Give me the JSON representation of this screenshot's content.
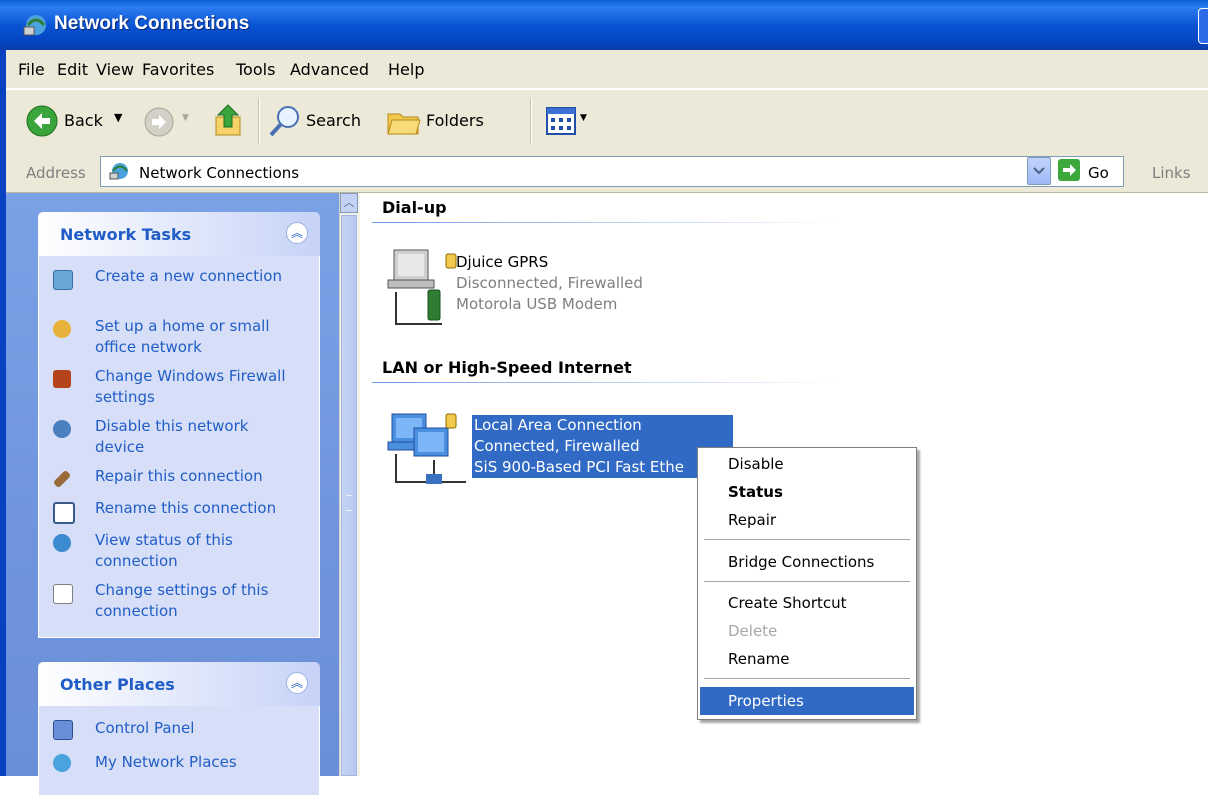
{
  "window": {
    "title": "Network Connections"
  },
  "menubar": {
    "items": [
      "File",
      "Edit",
      "View",
      "Favorites",
      "Tools",
      "Advanced",
      "Help"
    ]
  },
  "toolbar": {
    "back_label": "Back",
    "search_label": "Search",
    "folders_label": "Folders"
  },
  "address_bar": {
    "label": "Address",
    "value": "Network Connections",
    "go_label": "Go",
    "links_label": "Links"
  },
  "task_pane": {
    "network_tasks": {
      "title": "Network Tasks",
      "items": [
        {
          "label": "Create a new connection",
          "icon": "new-connection-icon"
        },
        {
          "label": "Set up a home or small office network",
          "icon": "home-network-icon"
        },
        {
          "label": "Change Windows Firewall settings",
          "icon": "firewall-icon"
        },
        {
          "label": "Disable this network device",
          "icon": "disable-device-icon"
        },
        {
          "label": "Repair this connection",
          "icon": "repair-icon"
        },
        {
          "label": "Rename this connection",
          "icon": "rename-icon"
        },
        {
          "label": "View status of this connection",
          "icon": "status-icon"
        },
        {
          "label": "Change settings of this connection",
          "icon": "settings-icon"
        }
      ]
    },
    "other_places": {
      "title": "Other Places",
      "items": [
        {
          "label": "Control Panel",
          "icon": "control-panel-icon"
        },
        {
          "label": "My Network Places",
          "icon": "network-places-icon"
        }
      ]
    }
  },
  "content": {
    "groups": [
      {
        "title": "Dial-up",
        "connections": [
          {
            "name": "Djuice GPRS",
            "status": "Disconnected, Firewalled",
            "device": "Motorola USB Modem"
          }
        ]
      },
      {
        "title": "LAN or High-Speed Internet",
        "connections": [
          {
            "name": "Local Area Connection",
            "status": "Connected, Firewalled",
            "device": "SiS 900-Based PCI Fast Ethe"
          }
        ]
      }
    ]
  },
  "context_menu": {
    "items": [
      {
        "label": "Disable"
      },
      {
        "label": "Status",
        "bold": true
      },
      {
        "label": "Repair"
      },
      {
        "label": "Bridge Connections"
      },
      {
        "label": "Create Shortcut"
      },
      {
        "label": "Delete",
        "disabled": true
      },
      {
        "label": "Rename"
      },
      {
        "label": "Properties",
        "selected": true
      }
    ]
  },
  "colors": {
    "titlebar": "#0a55d5",
    "selection": "#316ac5",
    "task_pane": "#7aa1e6",
    "task_link": "#215dc6"
  }
}
